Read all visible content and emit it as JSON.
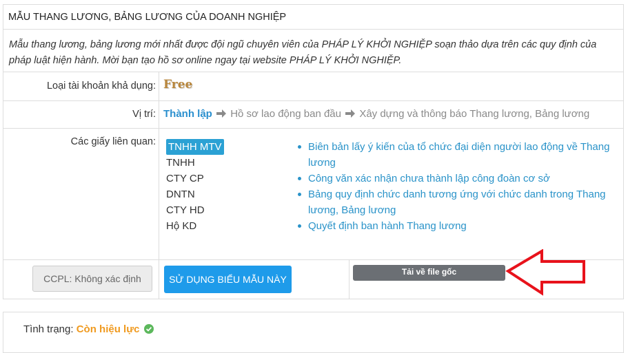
{
  "header": {
    "title": "MẪU THANG LƯƠNG, BẢNG LƯƠNG CỦA DOANH NGHIỆP",
    "description": "Mẫu thang lương, bảng lương mới nhất được đội ngũ chuyên viên của PHÁP LÝ KHỞI NGHIỆP soạn thảo dựa trên các quy định của pháp luật hiện hành. Mời bạn tạo hồ sơ online ngay tại website PHÁP LÝ KHỞI NGHIỆP."
  },
  "account": {
    "label": "Loại tài khoản khả dụng:",
    "value": "Free"
  },
  "position": {
    "label": "Vị trí:",
    "crumbs": [
      "Thành lập",
      "Hồ sơ lao động ban đầu",
      "Xây dựng và thông báo Thang lương, Bảng lương"
    ]
  },
  "related": {
    "label": "Các giấy liên quan:",
    "types": [
      "TNHH MTV",
      "TNHH",
      "CTY CP",
      "DNTN",
      "CTY HD",
      "Hộ KD"
    ],
    "active_type": "TNHH MTV",
    "documents": [
      "Biên bản lấy ý kiến của tổ chức đại diện người lao động về Thang lương",
      "Công văn xác nhận chưa thành lập công đoàn cơ sở",
      "Bảng quy định chức danh tương ứng với chức danh trong Thang lương, Bảng lương",
      "Quyết định ban hành Thang lương"
    ]
  },
  "actions": {
    "ccpl_label": "CCPL: Không xác định",
    "use_label": "SỬ DỤNG BIỂU MẪU NÀY",
    "download_label": "Tải về file gốc"
  },
  "status": {
    "label": "Tình trạng:",
    "value": "Còn hiệu lực"
  },
  "colors": {
    "accent_blue": "#1e9bea",
    "link": "#2a93c9",
    "free_gold": "#b8863b",
    "status_orange": "#f09a1f",
    "arrow_red": "#e8121b"
  },
  "icons": {
    "crumb_separator": "arrow-right-icon",
    "status_icon": "check-circle-icon",
    "annotation": "red-arrow-annotation"
  }
}
